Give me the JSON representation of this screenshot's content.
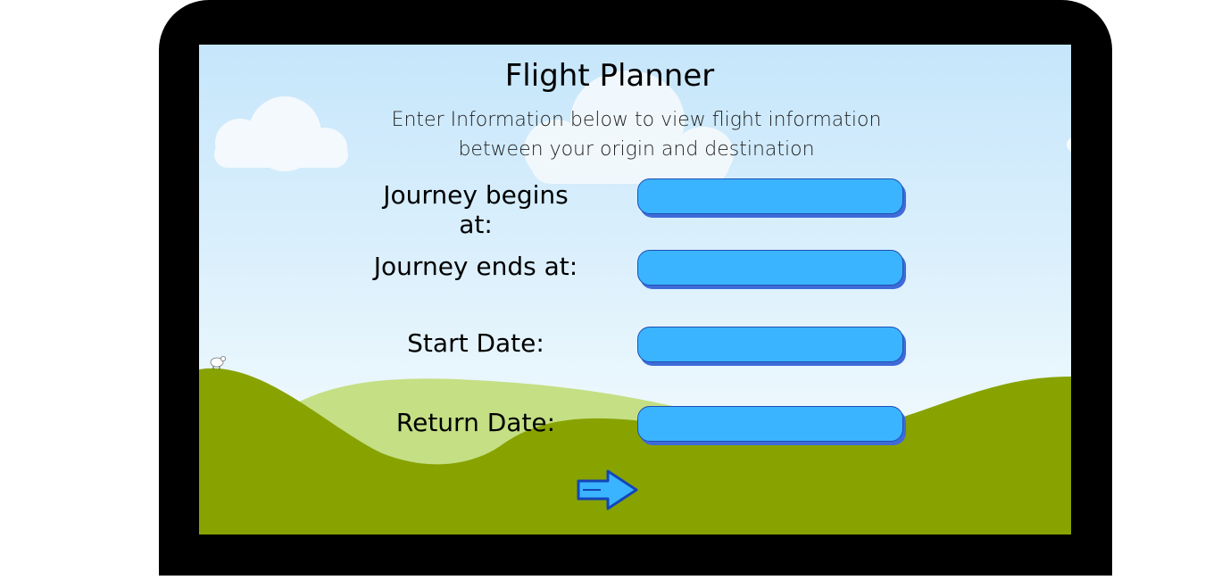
{
  "app": {
    "title": "Flight Planner",
    "subtitle": "Enter Information below to view flight information between your origin and destination"
  },
  "form": {
    "fields": [
      {
        "label": "Journey begins at:",
        "value": ""
      },
      {
        "label": "Journey ends at:",
        "value": ""
      },
      {
        "label": "Start Date:",
        "value": ""
      },
      {
        "label": "Return Date:",
        "value": ""
      }
    ],
    "submit_icon": "right-arrow-icon"
  },
  "colors": {
    "input_fill": "#3bb4ff",
    "input_border": "#1f4fb4",
    "hill_dark": "#88a300",
    "hill_light": "#c4df84",
    "frame": "#000000"
  }
}
